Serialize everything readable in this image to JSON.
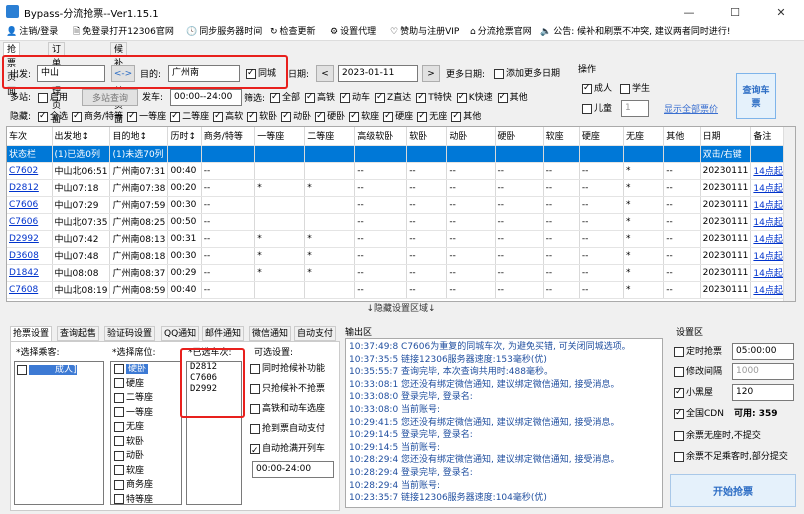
{
  "window": {
    "title": "Bypass-分流抢票--Ver1.15.1",
    "min": "—",
    "max": "☐",
    "close": "✕"
  },
  "menu": [
    {
      "icon": "user-icon",
      "glyph": "👤",
      "label": "注销/登录"
    },
    {
      "icon": "doc-icon",
      "glyph": "🗎",
      "label": "免登录打开12306官网"
    },
    {
      "icon": "clock-icon",
      "glyph": "🕓",
      "label": "同步服务器时间"
    },
    {
      "icon": "refresh-icon",
      "glyph": "↻",
      "label": "检查更新"
    },
    {
      "icon": "gear-icon",
      "glyph": "⚙",
      "label": "设置代理"
    },
    {
      "icon": "heart-icon",
      "glyph": "♡",
      "label": "赞助与注册VIP"
    },
    {
      "icon": "home-icon",
      "glyph": "⌂",
      "label": "分流抢票官网"
    },
    {
      "icon": "speaker-icon",
      "glyph": "🔈",
      "label": "公告: 候补和刷票不冲突, 建议两者同时进行!"
    }
  ],
  "tabs": [
    "抢票页面",
    "订单管理页面",
    "候补订单页面"
  ],
  "query": {
    "from_label": "出发:",
    "from": "中山",
    "swap": "<->",
    "to_label": "目的:",
    "to": "广州南",
    "same_city": "同城",
    "date_label": "日期:",
    "prev": "<",
    "date": "2023-01-11",
    "next": ">",
    "more_dates_label": "更多日期:",
    "add_more_dates": "添加更多日期",
    "multi_label": "多站:",
    "enable": "启用",
    "multi_query": "多站查询",
    "depart_label": "发车:",
    "depart_time": "00:00--24:00",
    "filter_label": "筛选:",
    "filters": [
      "全部",
      "高铁",
      "动车",
      "Z直达",
      "T特快",
      "K快速",
      "其他"
    ],
    "hide_label": "隐藏:",
    "hides": [
      "全选",
      "商务/特等",
      "一等座",
      "二等座",
      "高软",
      "软卧",
      "动卧",
      "硬卧",
      "软座",
      "硬座",
      "无座",
      "其他"
    ]
  },
  "ops": {
    "title": "操作",
    "adult": "成人",
    "student": "学生",
    "child": "儿童",
    "child_count": "1",
    "show_all": "显示全部票价",
    "query_btn": "查询车票"
  },
  "table": {
    "headers": [
      "车次",
      "出发地↕",
      "目的地↕",
      "历时↕",
      "商务/特等",
      "一等座",
      "二等座",
      "高级软卧",
      "软卧",
      "动卧",
      "硬卧",
      "软座",
      "硬座",
      "无座",
      "其他",
      "日期",
      "备注"
    ],
    "status_row": [
      "状态栏",
      "(1)已选0列",
      "(1)未选70列",
      "",
      "",
      "",
      "",
      "",
      "",
      "",
      "",
      "",
      "",
      "",
      "",
      "双击/右键",
      ""
    ],
    "rows": [
      [
        "C7602",
        "中山北06:51",
        "广州南07:31",
        "00:40",
        "--",
        "",
        "",
        "--",
        "--",
        "--",
        "--",
        "--",
        "--",
        "*",
        "--",
        "20230111",
        "14点起售"
      ],
      [
        "D2812",
        "中山07:18",
        "广州南07:38",
        "00:20",
        "--",
        "*",
        "*",
        "--",
        "--",
        "--",
        "--",
        "--",
        "--",
        "*",
        "--",
        "20230111",
        "14点起售"
      ],
      [
        "C7606",
        "中山07:29",
        "广州南07:59",
        "00:30",
        "--",
        "",
        "",
        "--",
        "--",
        "--",
        "--",
        "--",
        "--",
        "*",
        "--",
        "20230111",
        "14点起售"
      ],
      [
        "C7606",
        "中山北07:35",
        "广州南08:25",
        "00:50",
        "--",
        "",
        "",
        "--",
        "--",
        "--",
        "--",
        "--",
        "--",
        "*",
        "--",
        "20230111",
        "14点起售"
      ],
      [
        "D2992",
        "中山07:42",
        "广州南08:13",
        "00:31",
        "--",
        "*",
        "*",
        "--",
        "--",
        "--",
        "--",
        "--",
        "--",
        "*",
        "--",
        "20230111",
        "14点起售"
      ],
      [
        "D3608",
        "中山07:48",
        "广州南08:18",
        "00:30",
        "--",
        "*",
        "*",
        "--",
        "--",
        "--",
        "--",
        "--",
        "--",
        "*",
        "--",
        "20230111",
        "14点起售"
      ],
      [
        "D1842",
        "中山08:08",
        "广州南08:37",
        "00:29",
        "--",
        "*",
        "*",
        "--",
        "--",
        "--",
        "--",
        "--",
        "--",
        "*",
        "--",
        "20230111",
        "14点起售"
      ],
      [
        "C7608",
        "中山北08:19",
        "广州南08:59",
        "00:40",
        "--",
        "",
        "",
        "--",
        "--",
        "--",
        "--",
        "--",
        "--",
        "*",
        "--",
        "20230111",
        "14点起售"
      ]
    ]
  },
  "toggle_bar": "↓隐藏设置区域↓",
  "bottom_tabs": [
    "抢票设置",
    "查询起售",
    "验证码设置",
    "QQ通知",
    "邮件通知",
    "微信通知",
    "自动支付"
  ],
  "passengers": {
    "label": "*选择乘客:",
    "items": [
      "成人]"
    ]
  },
  "seats": {
    "label": "*选择席位:",
    "items": [
      {
        "name": "硬卧",
        "sel": true
      },
      {
        "name": "硬座"
      },
      {
        "name": "二等座"
      },
      {
        "name": "一等座"
      },
      {
        "name": "无座"
      },
      {
        "name": "软卧"
      },
      {
        "name": "动卧"
      },
      {
        "name": "软座"
      },
      {
        "name": "商务座"
      },
      {
        "name": "特等座"
      }
    ]
  },
  "selected_trains": {
    "label": "*已选车次:",
    "items": [
      "D2812",
      "C7606",
      "D2992"
    ]
  },
  "options": {
    "label": "可选设置:",
    "items": [
      {
        "t": "同时抢候补功能"
      },
      {
        "t": "只抢候补不抢票"
      },
      {
        "t": "高铁和动车选座"
      },
      {
        "t": "抢到票自动支付"
      },
      {
        "t": "自动抢满开列车",
        "on": true
      }
    ],
    "time": "00:00-24:00"
  },
  "log": {
    "label": "输出区",
    "lines": [
      "10:37:49:8  C7606为重复的同城车次, 为避免买错, 可关闭同城选项。",
      "10:37:35:5  链接12306服务器速度:153毫秒(优)",
      "10:35:55:7  查询完毕, 本次查询共用时:488毫秒。",
      "10:33:08:1  您还没有绑定微信通知, 建议绑定微信通知, 接受消息。",
      "10:33:08:0  登录完毕, 登录名:",
      "10:33:08:0  当前账号:",
      "10:29:41:5  您还没有绑定微信通知, 建议绑定微信通知, 接受消息。",
      "10:29:14:5  登录完毕, 登录名:",
      "10:29:14:5  当前账号:",
      "10:28:29:4  您还没有绑定微信通知, 建议绑定微信通知, 接受消息。",
      "10:28:29:4  登录完毕, 登录名:",
      "10:28:29:4  当前账号:",
      "10:23:35:7  链接12306服务器速度:104毫秒(优)"
    ]
  },
  "settings": {
    "title": "设置区",
    "timed": "定时抢票",
    "timed_val": "05:00:00",
    "interval": "修改间隔",
    "interval_val": "1000",
    "blackroom": "小黑屋",
    "blackroom_val": "120",
    "cdn": "全国CDN",
    "cdn_avail": "可用: 359",
    "opt1": "余票无座时,不提交",
    "opt2": "余票不足乘客时,部分提交",
    "start": "开始抢票"
  }
}
